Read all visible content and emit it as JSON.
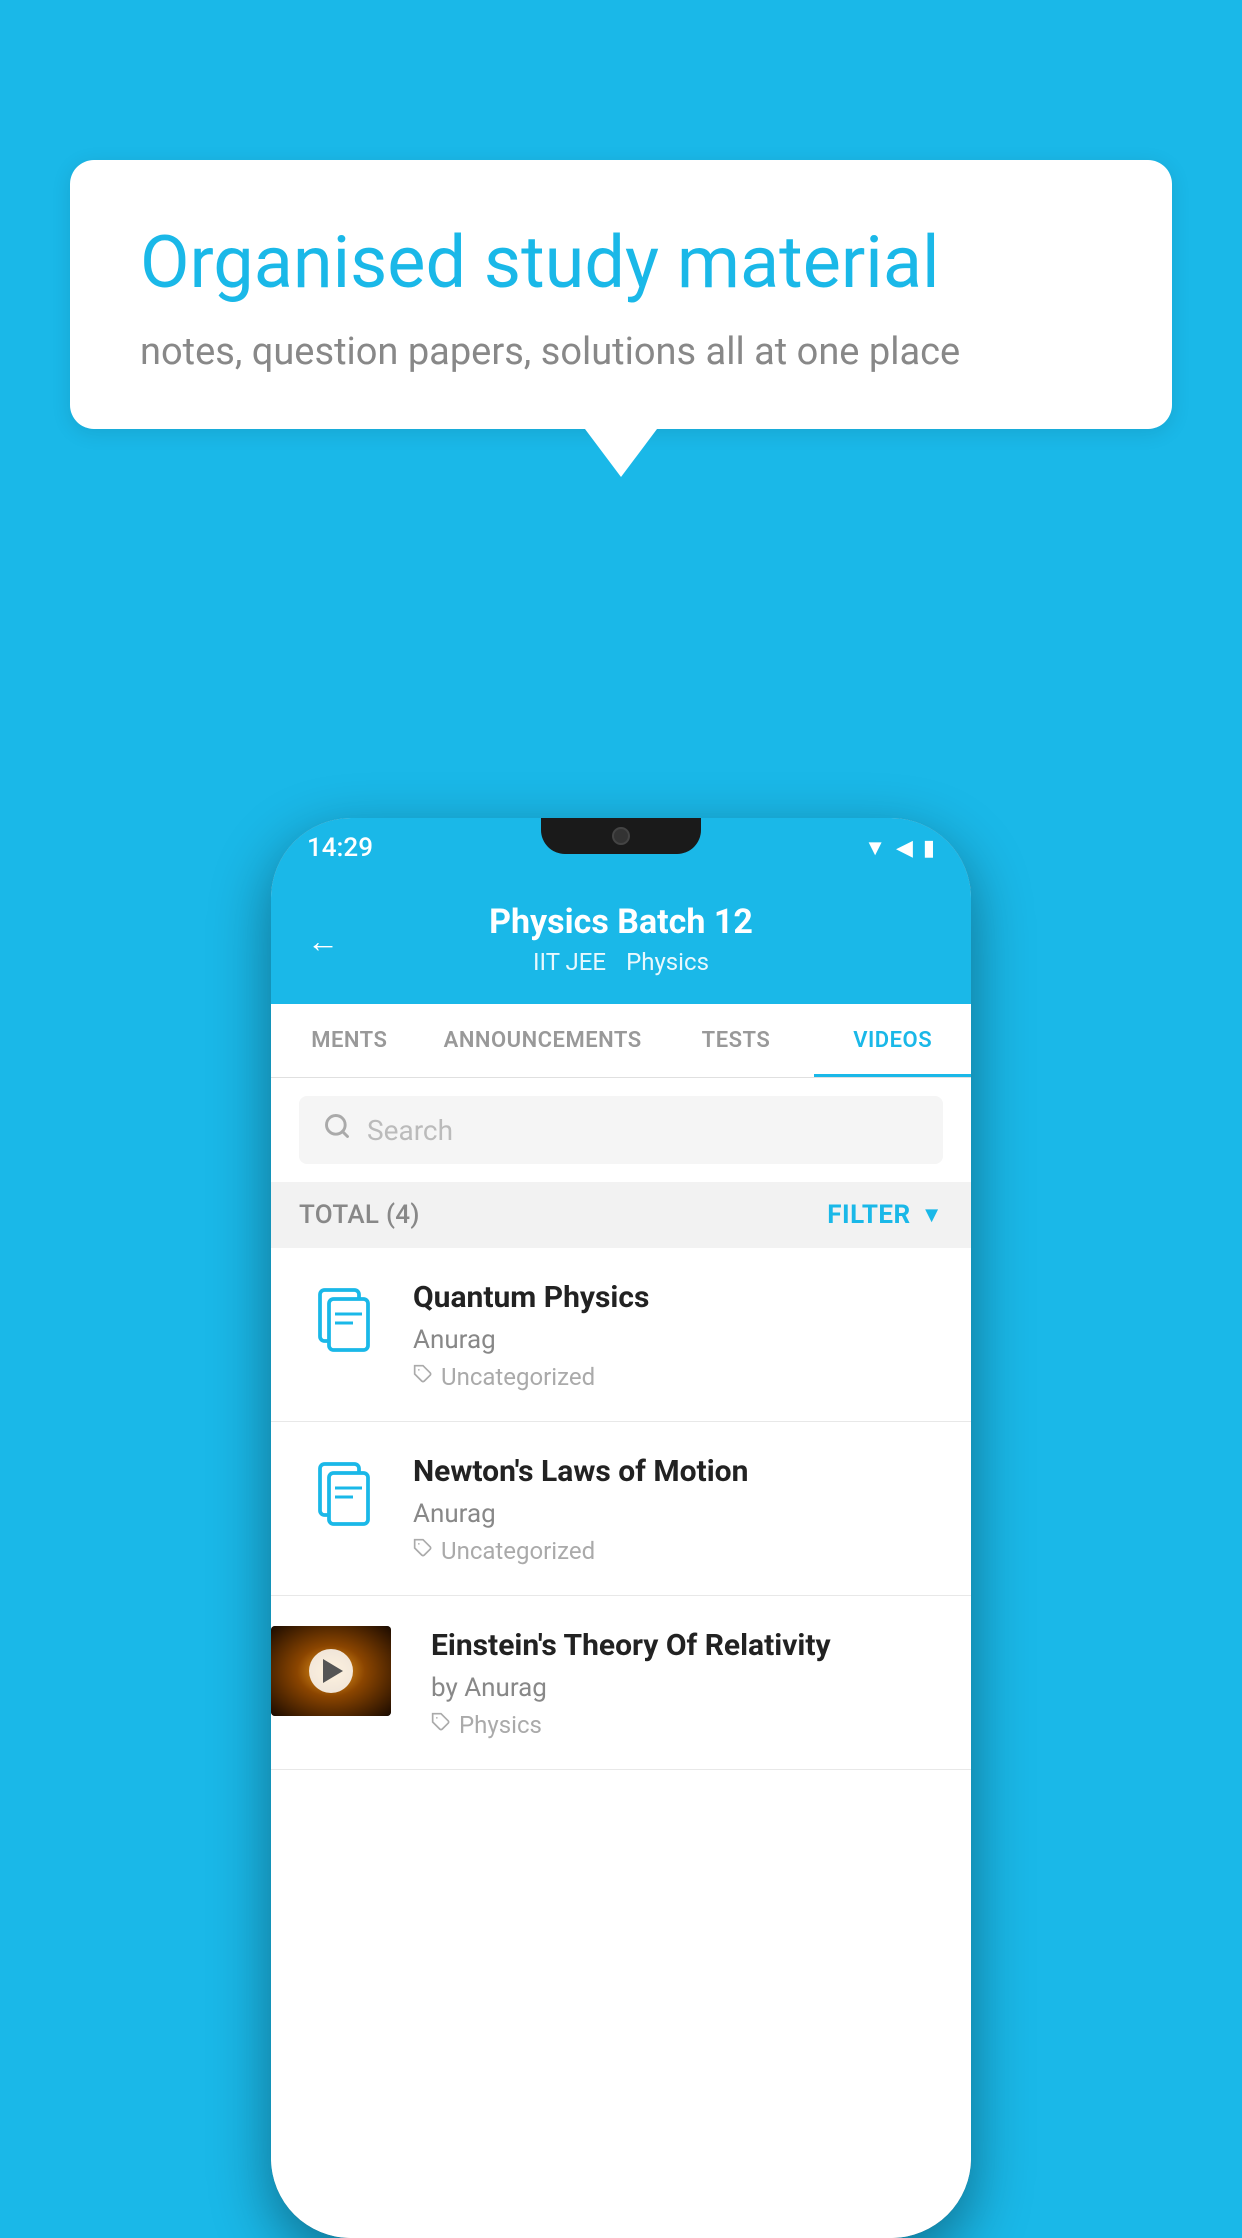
{
  "background": {
    "color": "#1ab8e8"
  },
  "bubble": {
    "title": "Organised study material",
    "subtitle": "notes, question papers, solutions all at one place"
  },
  "phone": {
    "status_bar": {
      "time": "14:29"
    },
    "header": {
      "title": "Physics Batch 12",
      "subtitle1": "IIT JEE",
      "subtitle2": "Physics",
      "back_label": "←"
    },
    "tabs": [
      {
        "label": "MENTS",
        "active": false
      },
      {
        "label": "ANNOUNCEMENTS",
        "active": false
      },
      {
        "label": "TESTS",
        "active": false
      },
      {
        "label": "VIDEOS",
        "active": true
      }
    ],
    "search": {
      "placeholder": "Search"
    },
    "filter": {
      "total_label": "TOTAL (4)",
      "filter_label": "FILTER"
    },
    "videos": [
      {
        "title": "Quantum Physics",
        "author": "Anurag",
        "tag": "Uncategorized",
        "has_thumb": false
      },
      {
        "title": "Newton's Laws of Motion",
        "author": "Anurag",
        "tag": "Uncategorized",
        "has_thumb": false
      },
      {
        "title": "Einstein's Theory Of Relativity",
        "author": "by Anurag",
        "tag": "Physics",
        "has_thumb": true
      }
    ]
  }
}
